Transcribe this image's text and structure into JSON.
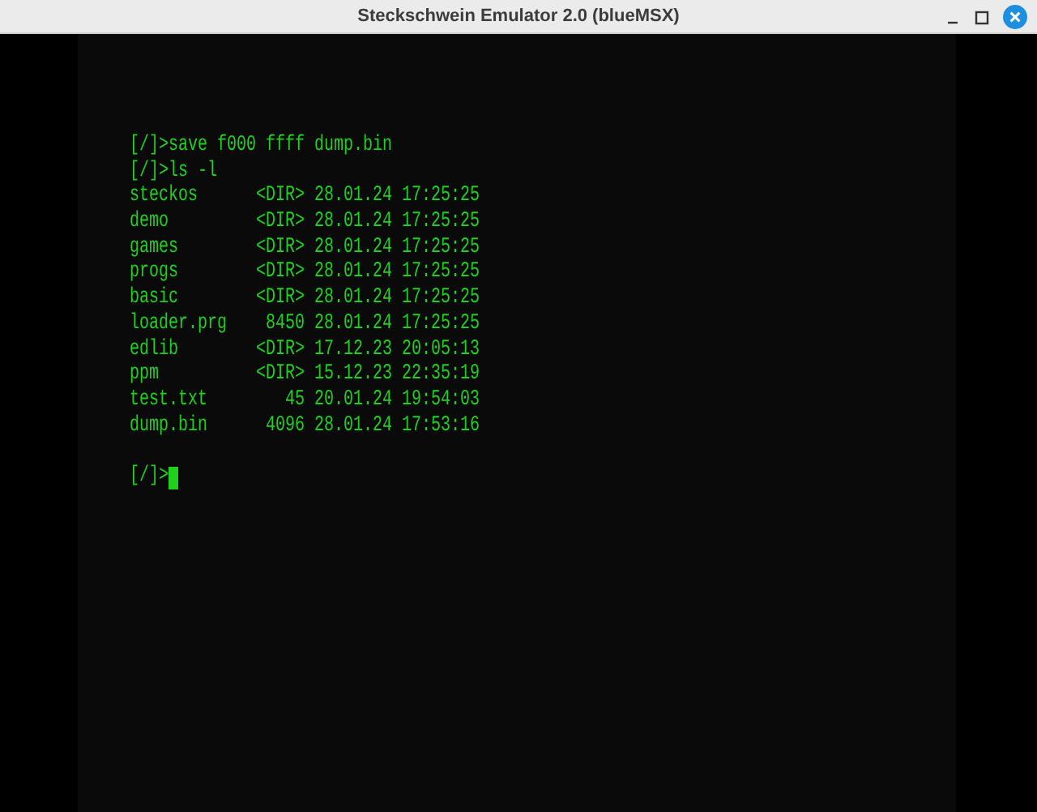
{
  "window": {
    "title": "Steckschwein Emulator 2.0 (blueMSX)"
  },
  "terminal": {
    "lines": [
      "[/]>save f000 ffff dump.bin",
      "[/]>ls -l",
      "steckos      <DIR> 28.01.24 17:25:25",
      "demo         <DIR> 28.01.24 17:25:25",
      "games        <DIR> 28.01.24 17:25:25",
      "progs        <DIR> 28.01.24 17:25:25",
      "basic        <DIR> 28.01.24 17:25:25",
      "loader.prg    8450 28.01.24 17:25:25",
      "edlib        <DIR> 17.12.23 20:05:13",
      "ppm          <DIR> 15.12.23 22:35:19",
      "test.txt        45 20.01.24 19:54:03",
      "dump.bin      4096 28.01.24 17:53:16"
    ],
    "prompt": "[/]>",
    "cursor_visible": true
  }
}
